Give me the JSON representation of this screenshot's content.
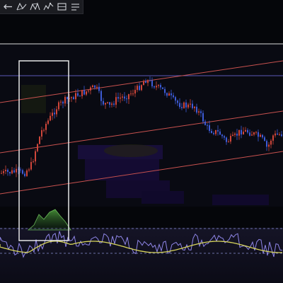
{
  "toolbar": {
    "tools": [
      {
        "name": "back-arrow-icon"
      },
      {
        "name": "triangle-pattern-icon"
      },
      {
        "name": "abcd-pattern-icon"
      },
      {
        "name": "zigzag-pattern-icon"
      },
      {
        "name": "rectangle-tool-icon"
      },
      {
        "name": "brush-tool-icon"
      }
    ]
  },
  "colors": {
    "background": "#05060a",
    "candle_up": "#d0463a",
    "candle_down": "#3d5bd6",
    "channel_line": "#c9524f",
    "horizontal_line": "#d9d9d9",
    "upper_band_line": "#5a58b8",
    "selection_box": "#e6e6e6",
    "oscillator_fast": "#8f86e8",
    "oscillator_slow": "#d7d45c",
    "volume_profile": "#1a0f40"
  }
}
